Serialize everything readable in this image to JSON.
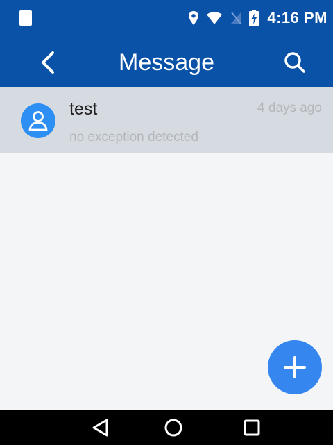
{
  "status_bar": {
    "time": "4:16 PM",
    "icons": [
      "notification-icon",
      "location-icon",
      "wifi-icon",
      "no-sim-icon",
      "battery-charging-icon"
    ]
  },
  "app_bar": {
    "title": "Message",
    "back_icon": "back-arrow-icon",
    "search_icon": "search-icon",
    "color": "#0a52a8"
  },
  "messages": [
    {
      "sender": "test",
      "time": "4 days ago",
      "preview": "no exception detected",
      "avatar_icon": "user-avatar-icon"
    }
  ],
  "fab": {
    "icon": "plus-icon",
    "color": "#3586ee"
  },
  "nav_bar": {
    "icons": [
      "nav-back-icon",
      "nav-home-icon",
      "nav-recents-icon"
    ]
  }
}
